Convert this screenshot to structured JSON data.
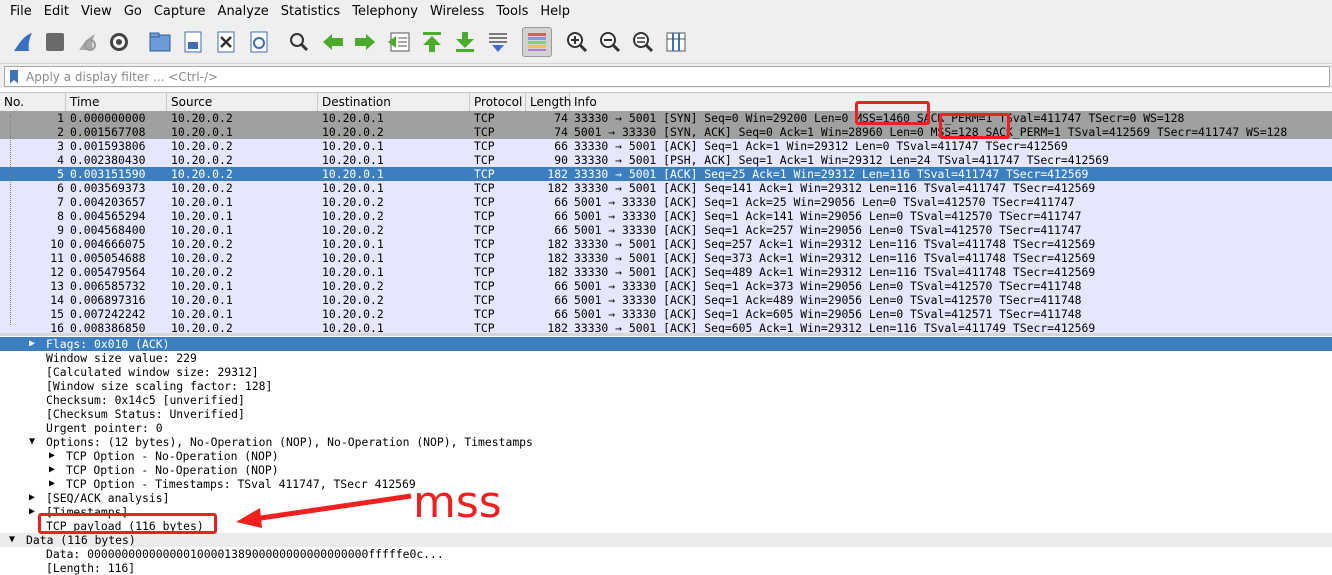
{
  "menu": [
    "File",
    "Edit",
    "View",
    "Go",
    "Capture",
    "Analyze",
    "Statistics",
    "Telephony",
    "Wireless",
    "Tools",
    "Help"
  ],
  "toolbar": {
    "icons": [
      "shark-fin-start-icon",
      "stop-square-icon",
      "restart-capture-icon",
      "capture-options-gear-icon",
      "open-folder-icon",
      "save-file-icon",
      "close-file-icon",
      "reload-file-icon",
      "find-packet-icon",
      "go-back-icon",
      "go-forward-icon",
      "go-to-packet-icon",
      "go-first-packet-icon",
      "go-last-packet-icon",
      "autoscroll-icon",
      "colorize-icon",
      "zoom-in-icon",
      "zoom-out-icon",
      "zoom-normal-icon",
      "resize-columns-icon"
    ]
  },
  "filter": {
    "placeholder": "Apply a display filter ... <Ctrl-/>"
  },
  "columns": [
    "No.",
    "Time",
    "Source",
    "Destination",
    "Protocol",
    "Length",
    "Info"
  ],
  "packets": [
    {
      "no": "1",
      "time": "0.000000000",
      "src": "10.20.0.2",
      "dst": "10.20.0.1",
      "proto": "TCP",
      "len": "74",
      "info": "33330 → 5001 [SYN] Seq=0 Win=29200 Len=0 MSS=1460 SACK_PERM=1 TSval=411747 TSecr=0 WS=128",
      "style": "gray"
    },
    {
      "no": "2",
      "time": "0.001567708",
      "src": "10.20.0.1",
      "dst": "10.20.0.2",
      "proto": "TCP",
      "len": "74",
      "info": "5001 → 33330 [SYN, ACK] Seq=0 Ack=1 Win=28960 Len=0 MSS=128 SACK_PERM=1 TSval=412569 TSecr=411747 WS=128",
      "style": "gray"
    },
    {
      "no": "3",
      "time": "0.001593806",
      "src": "10.20.0.2",
      "dst": "10.20.0.1",
      "proto": "TCP",
      "len": "66",
      "info": "33330 → 5001 [ACK] Seq=1 Ack=1 Win=29312 Len=0 TSval=411747 TSecr=412569",
      "style": "lav"
    },
    {
      "no": "4",
      "time": "0.002380430",
      "src": "10.20.0.2",
      "dst": "10.20.0.1",
      "proto": "TCP",
      "len": "90",
      "info": "33330 → 5001 [PSH, ACK] Seq=1 Ack=1 Win=29312 Len=24 TSval=411747 TSecr=412569",
      "style": "lav"
    },
    {
      "no": "5",
      "time": "0.003151590",
      "src": "10.20.0.2",
      "dst": "10.20.0.1",
      "proto": "TCP",
      "len": "182",
      "info": "33330 → 5001 [ACK] Seq=25 Ack=1 Win=29312 Len=116 TSval=411747 TSecr=412569",
      "style": "sel"
    },
    {
      "no": "6",
      "time": "0.003569373",
      "src": "10.20.0.2",
      "dst": "10.20.0.1",
      "proto": "TCP",
      "len": "182",
      "info": "33330 → 5001 [ACK] Seq=141 Ack=1 Win=29312 Len=116 TSval=411747 TSecr=412569",
      "style": "lav"
    },
    {
      "no": "7",
      "time": "0.004203657",
      "src": "10.20.0.1",
      "dst": "10.20.0.2",
      "proto": "TCP",
      "len": "66",
      "info": "5001 → 33330 [ACK] Seq=1 Ack=25 Win=29056 Len=0 TSval=412570 TSecr=411747",
      "style": "lav"
    },
    {
      "no": "8",
      "time": "0.004565294",
      "src": "10.20.0.1",
      "dst": "10.20.0.2",
      "proto": "TCP",
      "len": "66",
      "info": "5001 → 33330 [ACK] Seq=1 Ack=141 Win=29056 Len=0 TSval=412570 TSecr=411747",
      "style": "lav"
    },
    {
      "no": "9",
      "time": "0.004568400",
      "src": "10.20.0.1",
      "dst": "10.20.0.2",
      "proto": "TCP",
      "len": "66",
      "info": "5001 → 33330 [ACK] Seq=1 Ack=257 Win=29056 Len=0 TSval=412570 TSecr=411747",
      "style": "lav"
    },
    {
      "no": "10",
      "time": "0.004666075",
      "src": "10.20.0.2",
      "dst": "10.20.0.1",
      "proto": "TCP",
      "len": "182",
      "info": "33330 → 5001 [ACK] Seq=257 Ack=1 Win=29312 Len=116 TSval=411748 TSecr=412569",
      "style": "lav"
    },
    {
      "no": "11",
      "time": "0.005054688",
      "src": "10.20.0.2",
      "dst": "10.20.0.1",
      "proto": "TCP",
      "len": "182",
      "info": "33330 → 5001 [ACK] Seq=373 Ack=1 Win=29312 Len=116 TSval=411748 TSecr=412569",
      "style": "lav"
    },
    {
      "no": "12",
      "time": "0.005479564",
      "src": "10.20.0.2",
      "dst": "10.20.0.1",
      "proto": "TCP",
      "len": "182",
      "info": "33330 → 5001 [ACK] Seq=489 Ack=1 Win=29312 Len=116 TSval=411748 TSecr=412569",
      "style": "lav"
    },
    {
      "no": "13",
      "time": "0.006585732",
      "src": "10.20.0.1",
      "dst": "10.20.0.2",
      "proto": "TCP",
      "len": "66",
      "info": "5001 → 33330 [ACK] Seq=1 Ack=373 Win=29056 Len=0 TSval=412570 TSecr=411748",
      "style": "lav"
    },
    {
      "no": "14",
      "time": "0.006897316",
      "src": "10.20.0.1",
      "dst": "10.20.0.2",
      "proto": "TCP",
      "len": "66",
      "info": "5001 → 33330 [ACK] Seq=1 Ack=489 Win=29056 Len=0 TSval=412570 TSecr=411748",
      "style": "lav"
    },
    {
      "no": "15",
      "time": "0.007242242",
      "src": "10.20.0.1",
      "dst": "10.20.0.2",
      "proto": "TCP",
      "len": "66",
      "info": "5001 → 33330 [ACK] Seq=1 Ack=605 Win=29056 Len=0 TSval=412571 TSecr=411748",
      "style": "lav"
    },
    {
      "no": "16",
      "time": "0.008386850",
      "src": "10.20.0.2",
      "dst": "10.20.0.1",
      "proto": "TCP",
      "len": "182",
      "info": "33330 → 5001 [ACK] Seq=605 Ack=1 Win=29312 Len=116 TSval=411749 TSecr=412569",
      "style": "lav"
    }
  ],
  "details": [
    {
      "text": "Flags: 0x010 (ACK)",
      "arrow": "collapsed",
      "level": 2,
      "style": "sel"
    },
    {
      "text": "Window size value: 229",
      "arrow": "none",
      "level": 2,
      "style": ""
    },
    {
      "text": "[Calculated window size: 29312]",
      "arrow": "none",
      "level": 2,
      "style": ""
    },
    {
      "text": "[Window size scaling factor: 128]",
      "arrow": "none",
      "level": 2,
      "style": ""
    },
    {
      "text": "Checksum: 0x14c5 [unverified]",
      "arrow": "none",
      "level": 2,
      "style": ""
    },
    {
      "text": "[Checksum Status: Unverified]",
      "arrow": "none",
      "level": 2,
      "style": ""
    },
    {
      "text": "Urgent pointer: 0",
      "arrow": "none",
      "level": 2,
      "style": ""
    },
    {
      "text": "Options: (12 bytes), No-Operation (NOP), No-Operation (NOP), Timestamps",
      "arrow": "expanded",
      "level": 2,
      "style": ""
    },
    {
      "text": "TCP Option - No-Operation (NOP)",
      "arrow": "collapsed",
      "level": 3,
      "style": ""
    },
    {
      "text": "TCP Option - No-Operation (NOP)",
      "arrow": "collapsed",
      "level": 3,
      "style": ""
    },
    {
      "text": "TCP Option - Timestamps: TSval 411747, TSecr 412569",
      "arrow": "collapsed",
      "level": 3,
      "style": ""
    },
    {
      "text": "[SEQ/ACK analysis]",
      "arrow": "collapsed",
      "level": 2,
      "style": ""
    },
    {
      "text": "[Timestamps]",
      "arrow": "collapsed",
      "level": 2,
      "style": ""
    },
    {
      "text": "TCP payload (116 bytes)",
      "arrow": "none",
      "level": 2,
      "style": ""
    },
    {
      "text": "Data (116 bytes)",
      "arrow": "expanded",
      "level": 1,
      "style": "hdr"
    },
    {
      "text": "Data: 00000000000000010000138900000000000000000fffffe0c...",
      "arrow": "none",
      "level": 2,
      "style": ""
    },
    {
      "text": "[Length: 116]",
      "arrow": "none",
      "level": 2,
      "style": ""
    }
  ],
  "annotation": {
    "text": "mss",
    "color": "#ee2020"
  },
  "colors": {
    "selected": "#3c7fc1",
    "gray_row": "#a0a0a0",
    "tcp_row": "#e7e6ff",
    "annotation": "#ee2020"
  }
}
